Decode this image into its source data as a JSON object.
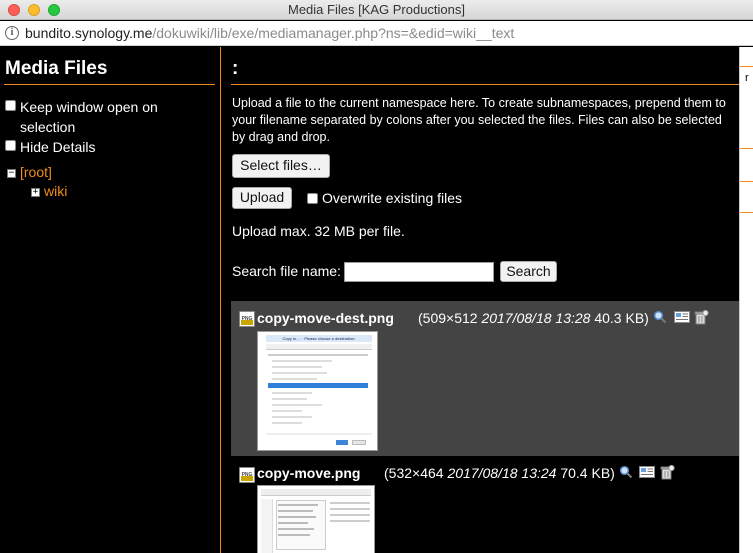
{
  "window": {
    "title": "Media Files [KAG Productions]"
  },
  "address_bar": {
    "host": "bundito.synology.me",
    "path": "/dokuwiki/lib/exe/mediamanager.php?ns=&edid=wiki__text"
  },
  "sidebar": {
    "title": "Media Files",
    "options": [
      {
        "label": "Keep window open on selection",
        "checked": false
      },
      {
        "label": "Hide Details",
        "checked": false
      }
    ],
    "tree": [
      {
        "label": "[root]",
        "toggle": "−",
        "expanded": true
      },
      {
        "label": "wiki",
        "toggle": "+",
        "expanded": false
      }
    ]
  },
  "main": {
    "namespace_title": ":",
    "intro": "Upload a file to the current namespace here. To create subnamespaces, prepend them to your filename separated by colons after you selected the files. Files can also be selected by drag and drop.",
    "select_files_label": "Select files…",
    "upload_label": "Upload",
    "overwrite_label": "Overwrite existing files",
    "upload_limit": "Upload max. 32 MB per file.",
    "search_label": "Search file name:",
    "search_value": "",
    "search_button": "Search",
    "files": [
      {
        "name": "copy-move-dest.png",
        "dims": "(509×512",
        "date": "2017/08/18 13:28",
        "size": "40.3 KB)",
        "thumb_caption": "Copy to ... · Please choose a destination:"
      },
      {
        "name": "copy-move.png",
        "dims": "(532×464",
        "date": "2017/08/18 13:24",
        "size": "70.4 KB)",
        "thumb_caption": ""
      }
    ]
  },
  "icons": {
    "file_type": "png-file-icon",
    "view": "magnifier-icon",
    "insert": "insert-link-icon",
    "delete": "delete-icon"
  },
  "colors": {
    "accent": "#f28b1e",
    "background": "#000000",
    "row_highlight": "#444444"
  }
}
